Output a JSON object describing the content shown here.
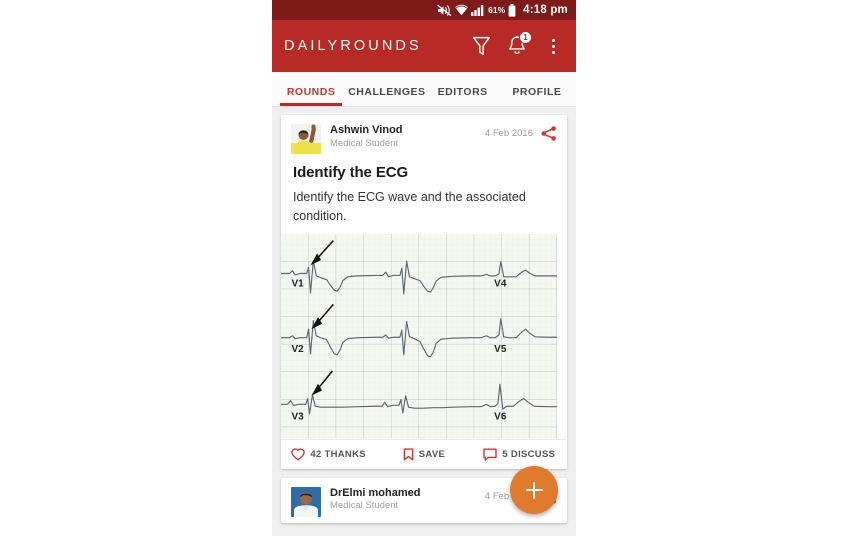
{
  "status_bar": {
    "battery_percent": "61%",
    "time": "4:18 pm",
    "icons": [
      "mute-icon",
      "wifi-icon",
      "signal-icon",
      "battery-icon"
    ]
  },
  "app_bar": {
    "brand": "DAILYROUNDS",
    "filter_icon": "filter-funnel-icon",
    "notifications_icon": "bell-icon",
    "notifications_badge": "1",
    "overflow_icon": "overflow-menu-icon"
  },
  "tabs": [
    {
      "label": "ROUNDS",
      "active": true
    },
    {
      "label": "CHALLENGES",
      "active": false
    },
    {
      "label": "EDITORS",
      "active": false
    },
    {
      "label": "PROFILE",
      "active": false
    }
  ],
  "posts": [
    {
      "author": "Ashwin Vinod",
      "role": "Medical Student",
      "date": "4 Feb 2016",
      "title": "Identify the ECG",
      "body": "Identify the ECG wave and the associated condition.",
      "share_icon": "share-icon",
      "image": {
        "type": "ecg-strip",
        "leads": [
          "V1",
          "V2",
          "V3",
          "V4",
          "V5",
          "V6"
        ],
        "annotation_arrows": 3
      },
      "actions": [
        {
          "icon": "heart-icon",
          "label": "42 THANKS"
        },
        {
          "icon": "bookmark-icon",
          "label": "SAVE"
        },
        {
          "icon": "comment-icon",
          "label": "5 DISCUSS"
        }
      ]
    },
    {
      "author": "DrElmi mohamed",
      "role": "Medical Student",
      "date": "4 Feb 2016",
      "share_icon": "share-icon"
    }
  ],
  "fab": {
    "icon": "plus-icon",
    "label": "+"
  },
  "colors": {
    "status_bar": "#7e1a17",
    "app_bar": "#b72a26",
    "accent_red": "#c0392b",
    "fab_orange": "#e07b2e",
    "page_bg": "#efefef",
    "card_bg": "#ffffff"
  }
}
